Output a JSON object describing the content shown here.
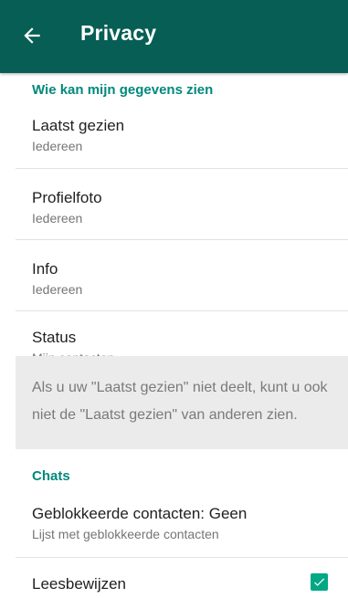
{
  "appbar": {
    "title": "Privacy",
    "back_icon": "arrow-left-icon",
    "color": "#075e54"
  },
  "sections": {
    "visibility": {
      "header": "Wie kan mijn gegevens zien",
      "items": [
        {
          "title": "Laatst gezien",
          "value": "Iedereen"
        },
        {
          "title": "Profielfoto",
          "value": "Iedereen"
        },
        {
          "title": "Info",
          "value": "Iedereen"
        },
        {
          "title": "Status",
          "value": "Mijn contacten"
        }
      ],
      "note": "Als u uw \"Laatst gezien\" niet deelt, kunt u ook niet de \"Laatst gezien\" van anderen zien."
    },
    "chats": {
      "header": "Chats",
      "blocked": {
        "title": "Geblokkeerde contacten: Geen",
        "subtitle": "Lijst met geblokkeerde contacten"
      },
      "read_receipts": {
        "title": "Leesbewijzen",
        "checked": true
      }
    }
  },
  "accent_color": "#00897b"
}
